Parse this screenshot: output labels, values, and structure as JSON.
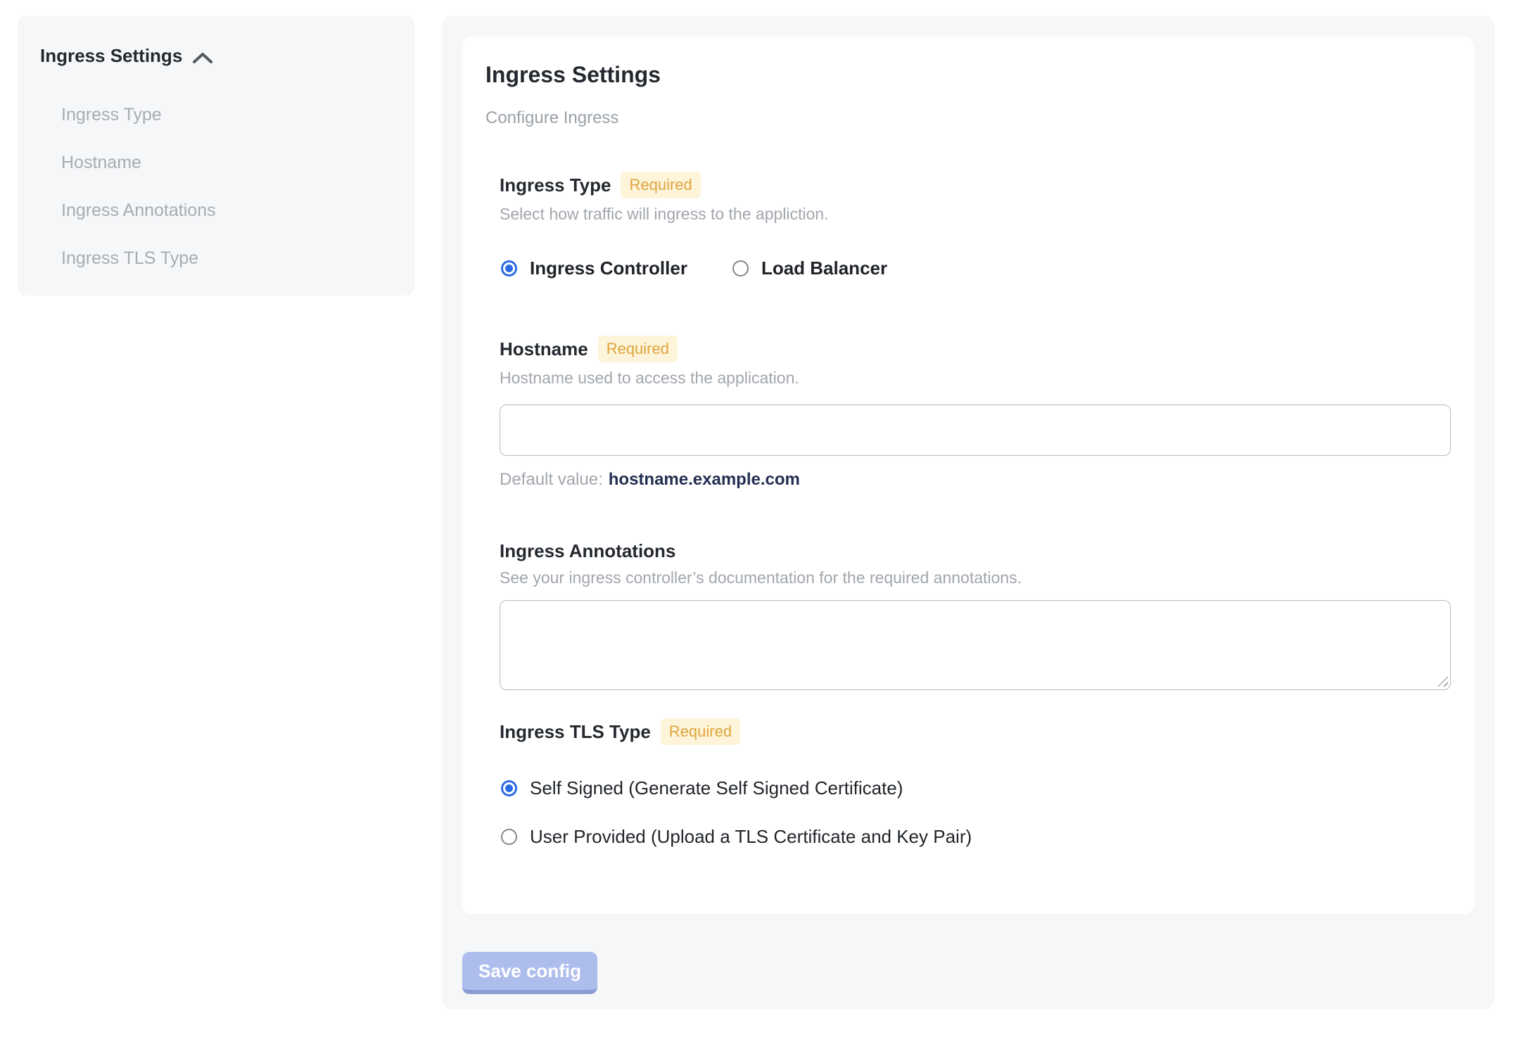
{
  "colors": {
    "panel_bg": "#f6f7f9",
    "card_bg": "#ffffff",
    "accent_blue": "#2b6be6",
    "badge_bg": "#fdf4d9",
    "badge_text": "#dfa53d",
    "muted_text": "#a1a6ad",
    "heading_text": "#24292f",
    "default_value_text": "#232f50",
    "save_button_bg": "#adbdec",
    "save_button_edge": "#8b9cd4"
  },
  "sidebar": {
    "title": "Ingress Settings",
    "collapse_icon": "chevron-up-icon",
    "items": [
      "Ingress Type",
      "Hostname",
      "Ingress Annotations",
      "Ingress TLS Type"
    ]
  },
  "main": {
    "title": "Ingress Settings",
    "subtitle": "Configure Ingress",
    "sections": {
      "ingress_type": {
        "label": "Ingress Type",
        "required_badge": "Required",
        "description": "Select how traffic will ingress to the appliction.",
        "options": [
          {
            "label": "Ingress Controller",
            "selected": true
          },
          {
            "label": "Load Balancer",
            "selected": false
          }
        ]
      },
      "hostname": {
        "label": "Hostname",
        "required_badge": "Required",
        "description": "Hostname used to access the application.",
        "input_value": "",
        "default_value_label": "Default value:",
        "default_value": "hostname.example.com"
      },
      "ingress_annotations": {
        "label": "Ingress Annotations",
        "description": "See your ingress controller’s documentation for the required annotations.",
        "textarea_value": ""
      },
      "ingress_tls_type": {
        "label": "Ingress TLS Type",
        "required_badge": "Required",
        "options": [
          {
            "label": "Self Signed (Generate Self Signed Certificate)",
            "selected": true
          },
          {
            "label": "User Provided (Upload a TLS Certificate and Key Pair)",
            "selected": false
          }
        ]
      }
    },
    "save_button_label": "Save config"
  }
}
